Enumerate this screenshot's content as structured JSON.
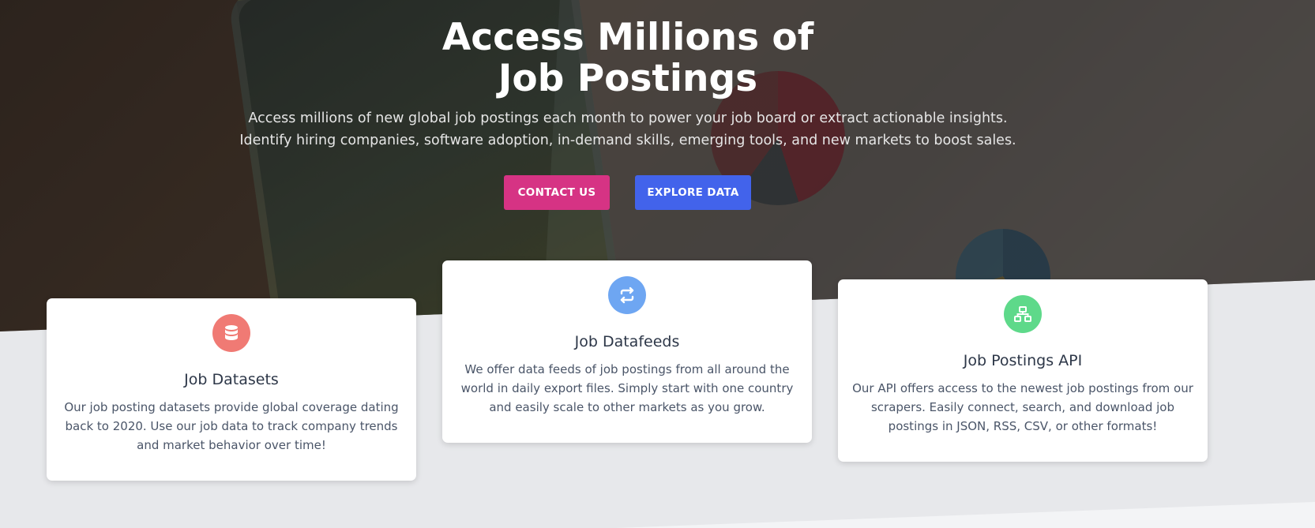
{
  "hero": {
    "title_line1": "Access Millions of",
    "title_line2": "Job Postings",
    "subtitle": "Access millions of new global job postings each month to power your job board or extract actionable insights. Identify hiring companies, software adoption, in-demand skills, emerging tools, and new markets to boost sales.",
    "contact_label": "CONTACT US",
    "explore_label": "EXPLORE DATA"
  },
  "cards": [
    {
      "icon": "database-icon",
      "title": "Job Datasets",
      "text": "Our job posting datasets provide global coverage dating back to 2020. Use our job data to track company trends and market behavior over time!"
    },
    {
      "icon": "sync-arrows-icon",
      "title": "Job Datafeeds",
      "text": "We offer data feeds of job postings from all around the world in daily export files. Simply start with one country and easily scale to other markets as you grow."
    },
    {
      "icon": "network-icon",
      "title": "Job Postings API",
      "text": "Our API offers access to the newest job postings from our scrapers. Easily connect, search, and download job postings in JSON, RSS, CSV, or other formats!"
    }
  ],
  "colors": {
    "contact": "#d63384",
    "explore": "#4263eb",
    "datasets_icon": "#f07a74",
    "datafeeds_icon": "#6ea6f2",
    "api_icon": "#5ed98a"
  }
}
